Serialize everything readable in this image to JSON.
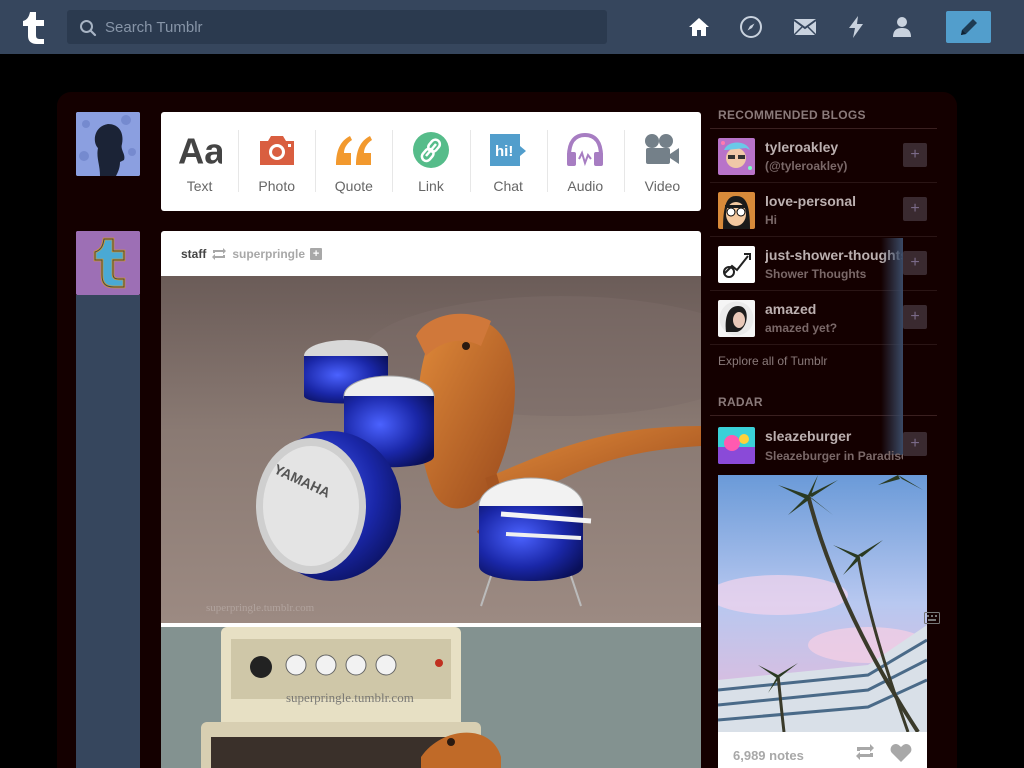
{
  "topbar": {
    "search_placeholder": "Search Tumblr",
    "nav": [
      "home-icon",
      "explore-icon",
      "inbox-icon",
      "activity-icon",
      "account-icon"
    ],
    "compose_icon": "pencil-icon",
    "colors": {
      "bar": "#36465d",
      "compose": "#529ecc"
    }
  },
  "post_types": [
    {
      "label": "Text",
      "icon": "text-icon",
      "color": "#444444"
    },
    {
      "label": "Photo",
      "icon": "photo-icon",
      "color": "#d95e40"
    },
    {
      "label": "Quote",
      "icon": "quote-icon",
      "color": "#f2992e"
    },
    {
      "label": "Link",
      "icon": "link-icon",
      "color": "#56bc8a"
    },
    {
      "label": "Chat",
      "icon": "chat-icon",
      "color": "#529ecc"
    },
    {
      "label": "Audio",
      "icon": "audio-icon",
      "color": "#a77dc2"
    },
    {
      "label": "Video",
      "icon": "video-icon",
      "color": "#748089"
    }
  ],
  "post": {
    "author": "staff",
    "reblogged_from": "superpringle",
    "watermark": "superpringle.tumblr.com"
  },
  "sidebar": {
    "recommended_title": "RECOMMENDED BLOGS",
    "blogs": [
      {
        "name": "tyleroakley",
        "sub": "(@tyleroakley)"
      },
      {
        "name": "love-personal",
        "sub": "Hi"
      },
      {
        "name": "just-shower-thoughts",
        "sub": "Shower Thoughts"
      },
      {
        "name": "amazed",
        "sub": "amazed yet?"
      }
    ],
    "explore": "Explore all of Tumblr",
    "radar_title": "RADAR",
    "radar": {
      "name": "sleazeburger",
      "sub": "Sleazeburger in Paradise",
      "notes": "6,989 notes"
    }
  }
}
